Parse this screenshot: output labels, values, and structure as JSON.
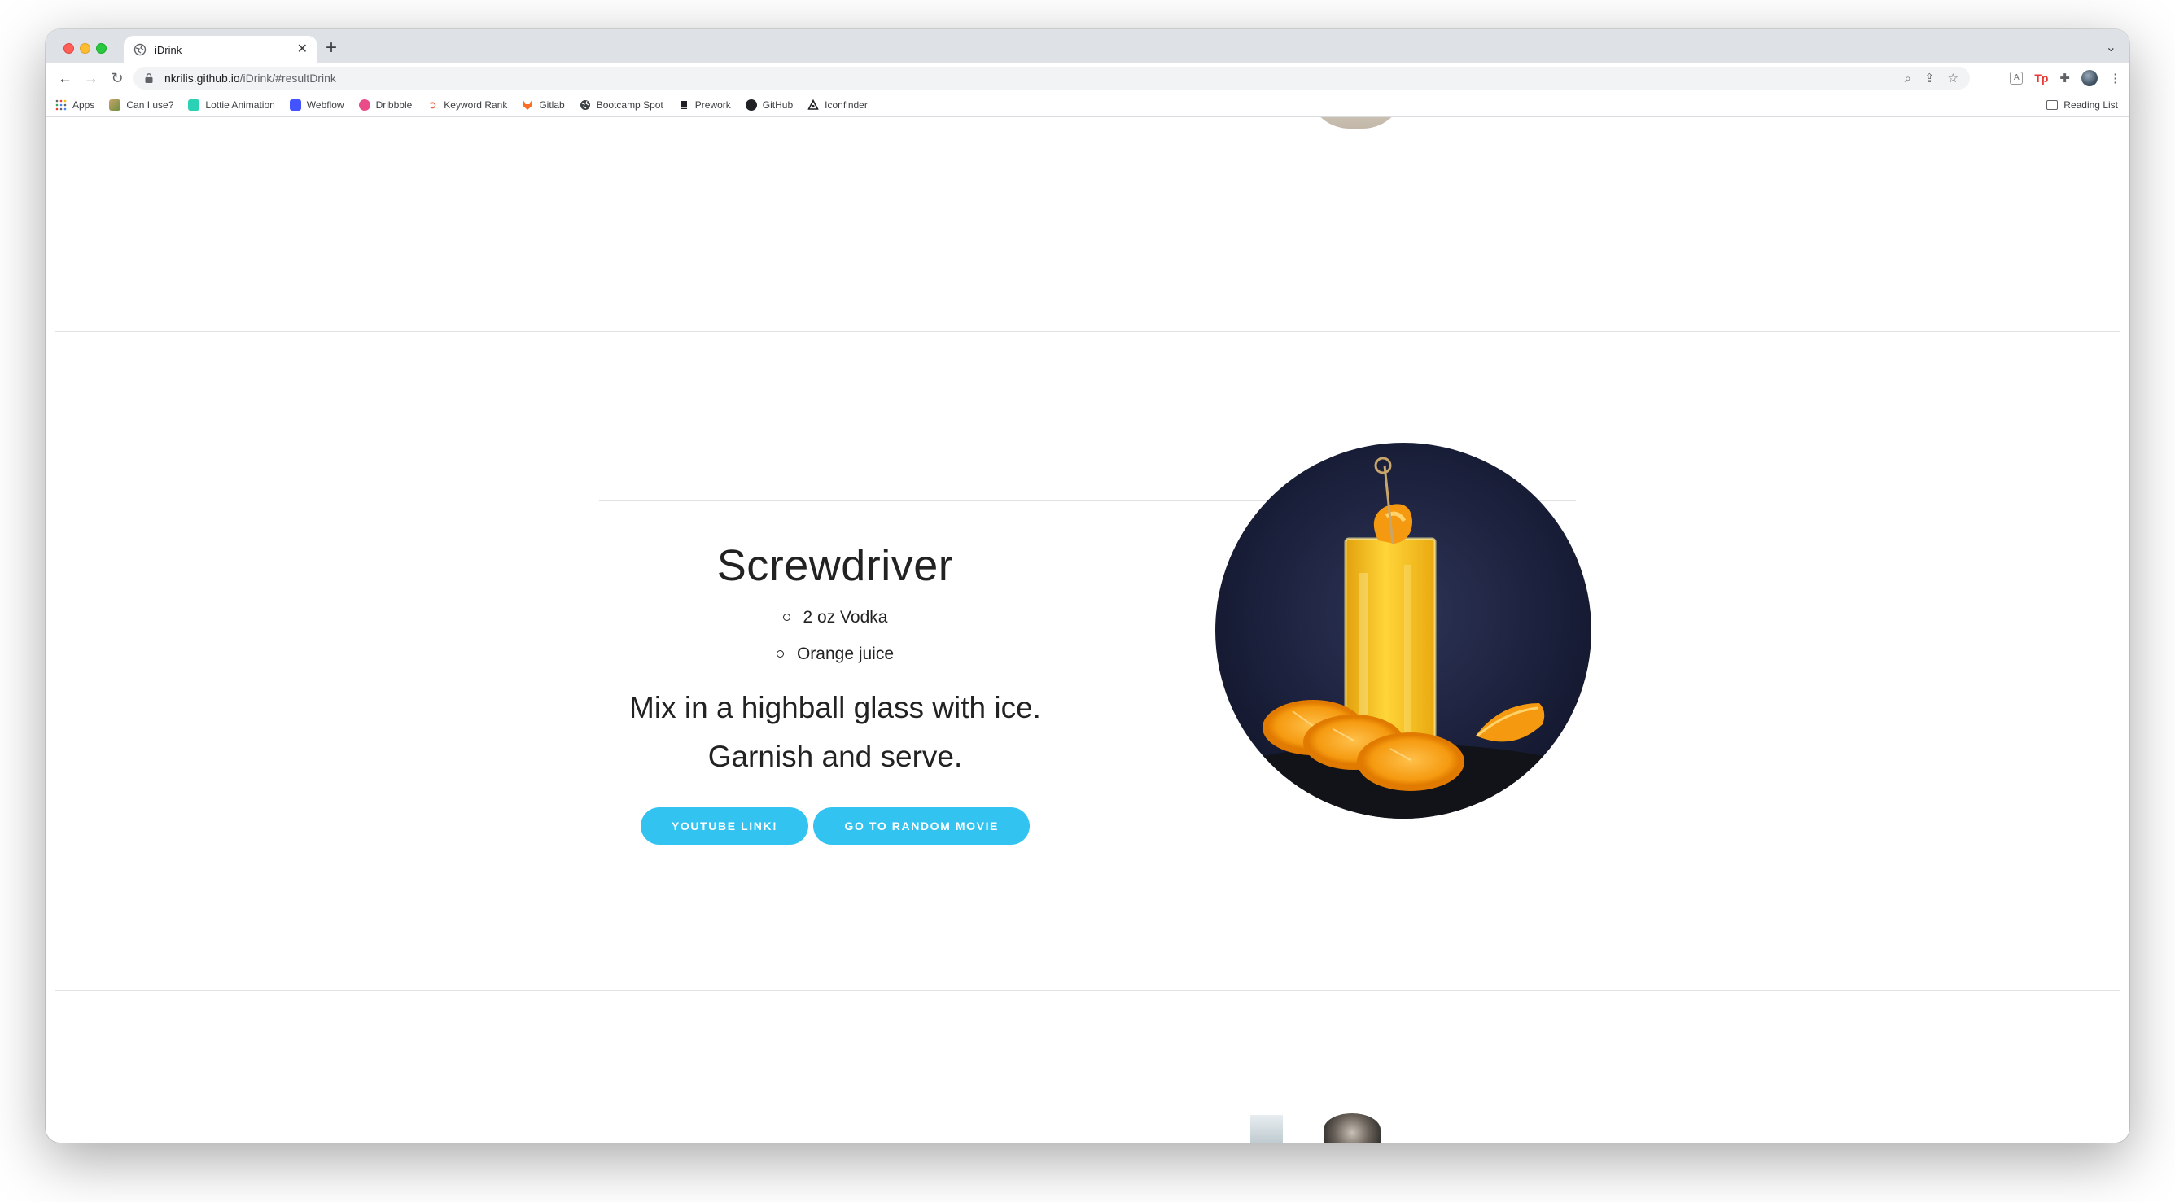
{
  "browser": {
    "tab": {
      "title": "iDrink"
    },
    "url": {
      "host": "nkrilis.github.io",
      "path": "/iDrink/#resultDrink"
    },
    "bookmarks": [
      {
        "label": "Apps",
        "icon": "apps-grid-icon"
      },
      {
        "label": "Can I use?",
        "icon": "caniuse-icon"
      },
      {
        "label": "Lottie Animation",
        "icon": "lottie-icon"
      },
      {
        "label": "Webflow",
        "icon": "webflow-icon"
      },
      {
        "label": "Dribbble",
        "icon": "dribbble-icon"
      },
      {
        "label": "Keyword Rank",
        "icon": "keyword-rank-icon"
      },
      {
        "label": "Gitlab",
        "icon": "gitlab-icon"
      },
      {
        "label": "Bootcamp Spot",
        "icon": "globe-icon"
      },
      {
        "label": "Prework",
        "icon": "book-icon"
      },
      {
        "label": "GitHub",
        "icon": "github-icon"
      },
      {
        "label": "Iconfinder",
        "icon": "iconfinder-icon"
      }
    ],
    "reading_list": "Reading List",
    "extension_tp": "Tp"
  },
  "drink": {
    "name": "Screwdriver",
    "ingredients": [
      "2 oz Vodka",
      "Orange juice"
    ],
    "instructions_line1": "Mix in a highball glass with ice.",
    "instructions_line2": "Garnish and serve.",
    "youtube_button": "YOUTUBE LINK!",
    "movie_button": "GO TO RANDOM MOVIE"
  },
  "colors": {
    "accent_button": "#33c3f0",
    "text": "#222222",
    "divider": "#e1e1e1"
  }
}
